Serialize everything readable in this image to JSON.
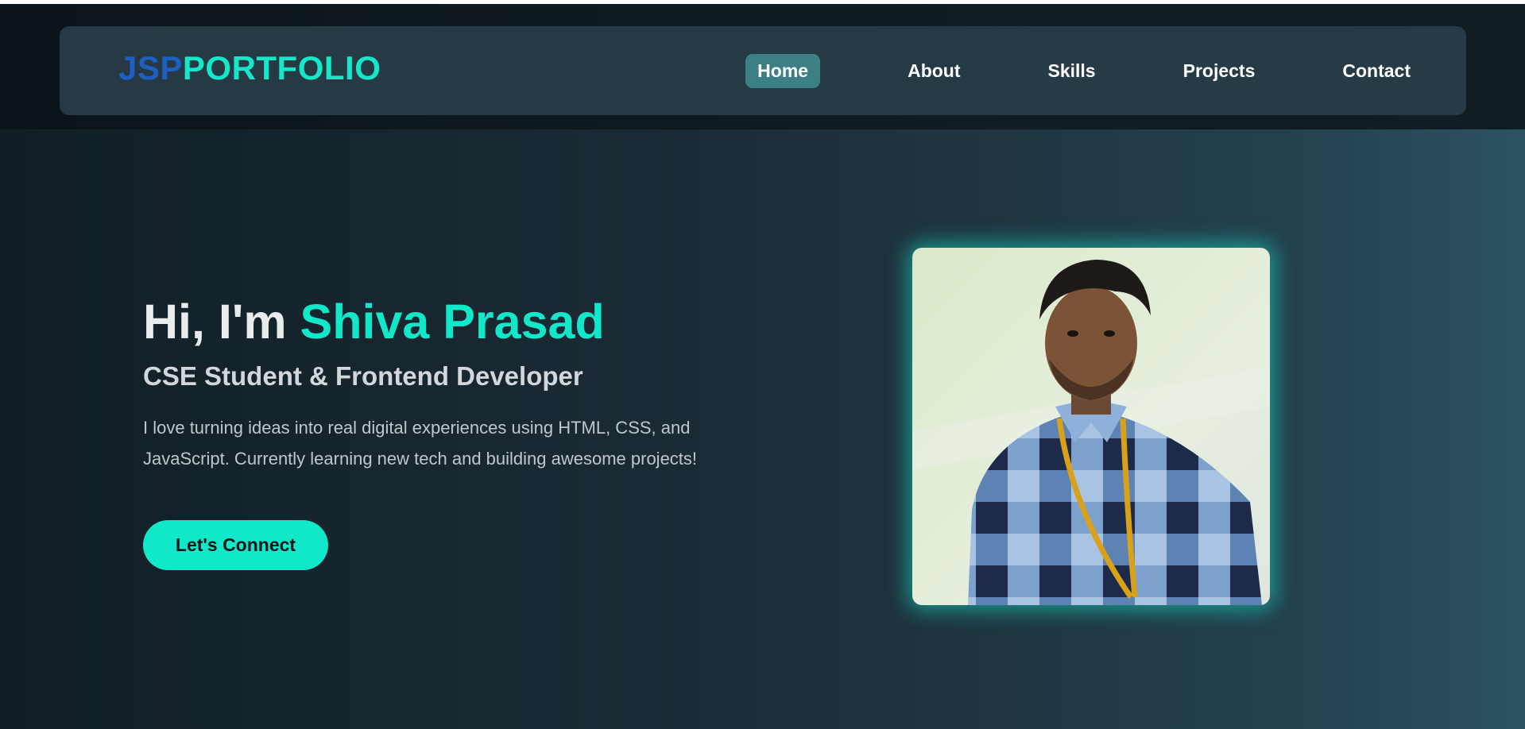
{
  "header": {
    "logo_part1": "JSP",
    "logo_part2": "PORTFOLIO",
    "nav": [
      "Home",
      "About",
      "Skills",
      "Projects",
      "Contact"
    ],
    "active_nav": "Home"
  },
  "hero": {
    "greeting": "Hi, I'm ",
    "name": "Shiva Prasad",
    "subtitle": "CSE Student & Frontend Developer",
    "description": "I love turning ideas into real digital experiences using HTML, CSS, and JavaScript. Currently learning new tech and building awesome projects!",
    "cta_label": "Let's Connect"
  },
  "colors": {
    "accent": "#12e8c9",
    "logo_blue": "#1e5fc2",
    "nav_active_bg": "#3c7f84"
  }
}
